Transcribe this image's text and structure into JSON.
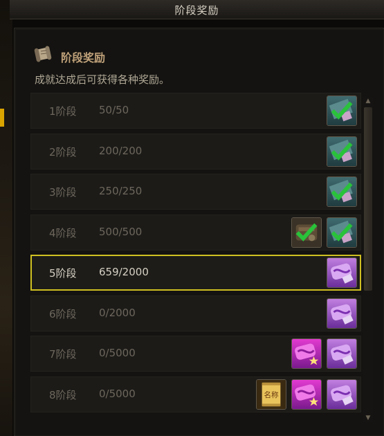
{
  "window": {
    "title": "阶段奖励"
  },
  "header": {
    "section_title": "阶段奖励",
    "description": "成就达成后可获得各种奖励。"
  },
  "stages": [
    {
      "label": "1阶段",
      "progress": "50/50",
      "active": false,
      "rewards": [
        "claimed-check-icon"
      ]
    },
    {
      "label": "2阶段",
      "progress": "200/200",
      "active": false,
      "rewards": [
        "claimed-check-icon"
      ]
    },
    {
      "label": "3阶段",
      "progress": "250/250",
      "active": false,
      "rewards": [
        "claimed-check-icon"
      ]
    },
    {
      "label": "4阶段",
      "progress": "500/500",
      "active": false,
      "rewards": [
        "claimed-item-check-icon",
        "claimed-check-icon"
      ]
    },
    {
      "label": "5阶段",
      "progress": "659/2000",
      "active": true,
      "rewards": [
        "purple-scroll-icon"
      ]
    },
    {
      "label": "6阶段",
      "progress": "0/2000",
      "active": false,
      "rewards": [
        "purple-scroll-icon"
      ]
    },
    {
      "label": "7阶段",
      "progress": "0/5000",
      "active": false,
      "rewards": [
        "pink-scroll-star-icon",
        "purple-scroll-icon"
      ]
    },
    {
      "label": "8阶段",
      "progress": "0/5000",
      "active": false,
      "rewards": [
        "name-card-icon",
        "pink-scroll-star-icon",
        "purple-scroll-icon"
      ],
      "name_card_text": "名称"
    }
  ],
  "colors": {
    "active_border": "#cfc021",
    "check_green": "#29c23a"
  }
}
